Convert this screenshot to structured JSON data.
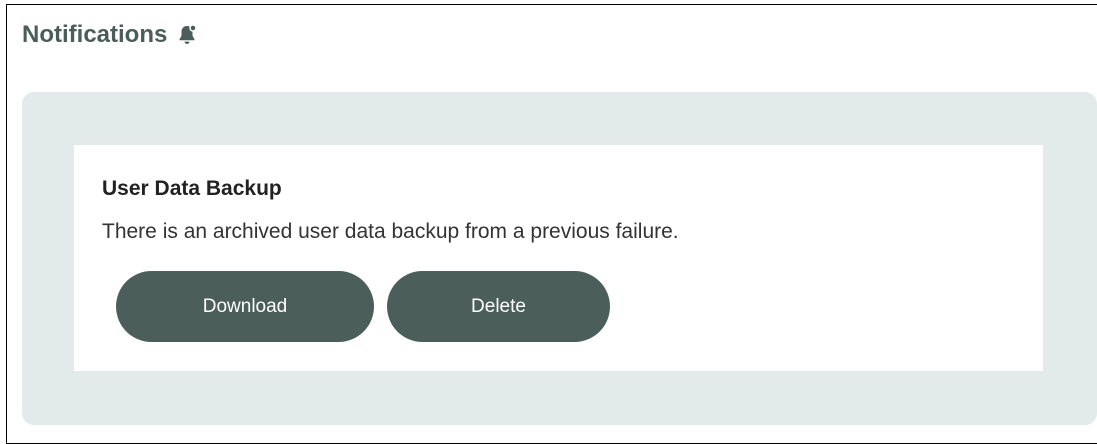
{
  "header": {
    "title": "Notifications",
    "icon": "bell-icon"
  },
  "notification": {
    "title": "User Data Backup",
    "message": "There is an archived user data backup from a previous failure.",
    "actions": {
      "download_label": "Download",
      "delete_label": "Delete"
    }
  },
  "colors": {
    "text_header": "#4a5d59",
    "panel_bg": "#e3eaea",
    "button_bg": "#4b5e59",
    "button_text": "#ffffff"
  }
}
